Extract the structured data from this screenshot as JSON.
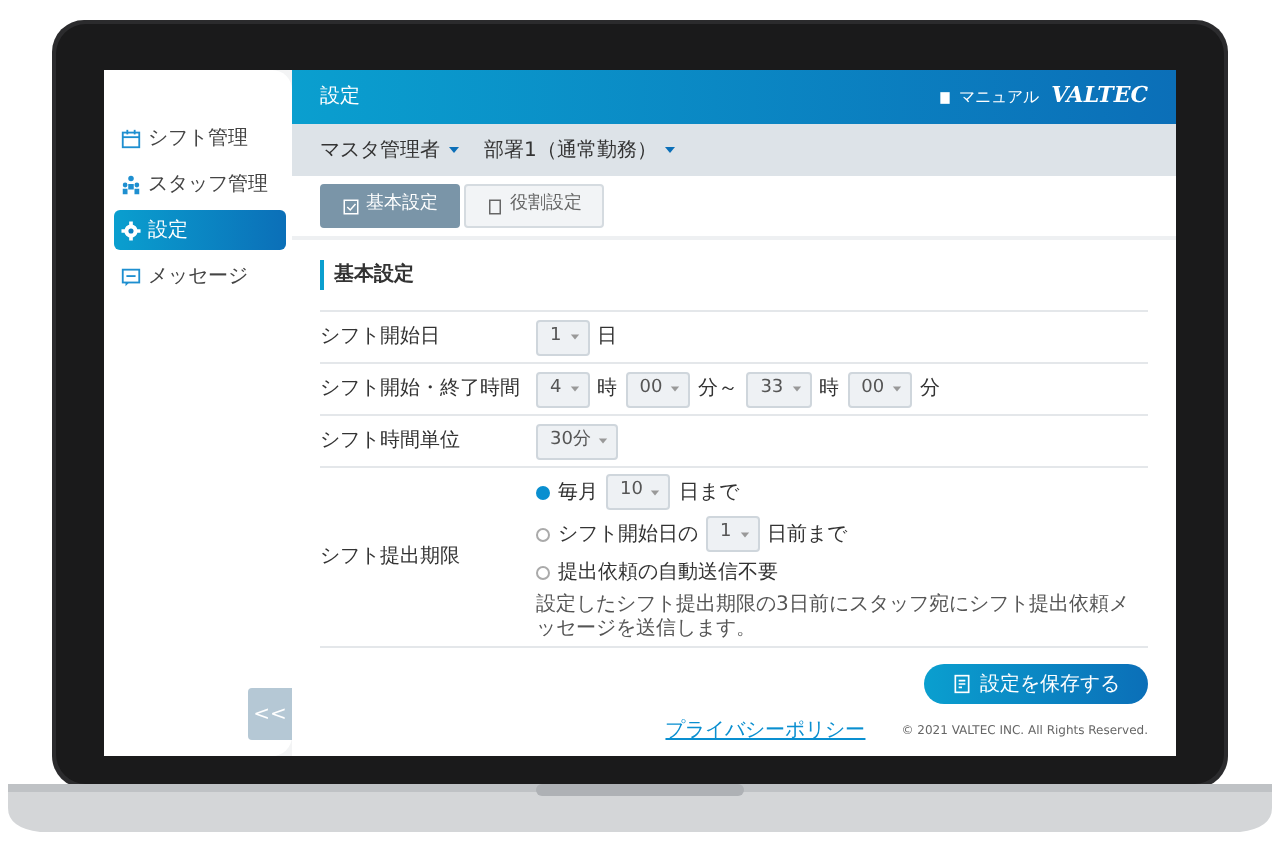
{
  "header": {
    "title": "設定",
    "manual_link": "マニュアル",
    "logo": "VALTEC"
  },
  "sidebar": {
    "items": [
      {
        "label": "シフト管理",
        "selected": false
      },
      {
        "label": "スタッフ管理",
        "selected": false
      },
      {
        "label": "設定",
        "selected": true
      },
      {
        "label": "メッセージ",
        "selected": false
      }
    ],
    "collapse_button": "<<"
  },
  "filters": [
    {
      "label": "マスタ管理者"
    },
    {
      "label": "部署1（通常勤務）"
    }
  ],
  "tabs": [
    {
      "label": "基本設定",
      "selected": true
    },
    {
      "label": "役割設定",
      "selected": false
    }
  ],
  "section_title": "基本設定",
  "form_rows": [
    {
      "label": "シフト開始日",
      "kind": "inline",
      "parts": [
        {
          "kind": "select",
          "value": "1"
        },
        {
          "kind": "text",
          "text": "日"
        }
      ]
    },
    {
      "label": "シフト開始・終了時間",
      "kind": "inline",
      "parts": [
        {
          "kind": "select",
          "value": "4"
        },
        {
          "kind": "text",
          "text": "時"
        },
        {
          "kind": "select",
          "value": "00"
        },
        {
          "kind": "text",
          "text": "分～"
        },
        {
          "kind": "select",
          "value": "33"
        },
        {
          "kind": "text",
          "text": "時"
        },
        {
          "kind": "select",
          "value": "00"
        },
        {
          "kind": "text",
          "text": "分"
        }
      ]
    },
    {
      "label": "シフト時間単位",
      "kind": "inline",
      "parts": [
        {
          "kind": "select",
          "value": "30分"
        }
      ]
    },
    {
      "label": "シフト提出期限",
      "kind": "radio",
      "options": [
        {
          "selected": true,
          "parts": [
            {
              "kind": "text",
              "text": "毎月"
            },
            {
              "kind": "select",
              "value": "10"
            },
            {
              "kind": "text",
              "text": "日まで"
            }
          ]
        },
        {
          "selected": false,
          "parts": [
            {
              "kind": "text",
              "text": "シフト開始日の"
            },
            {
              "kind": "select",
              "value": "1"
            },
            {
              "kind": "text",
              "text": "日前まで"
            }
          ]
        },
        {
          "selected": false,
          "parts": [
            {
              "kind": "text",
              "text": "提出依頼の自動送信不要"
            }
          ]
        }
      ],
      "note": "設定したシフト提出期限の3日前にスタッフ宛にシフト提出依頼メッセージを送信します。"
    }
  ],
  "save_button": "設定を保存する",
  "footer": {
    "privacy_link": "プライバシーポリシー",
    "copyright": "© 2021 VALTEC INC. All Rights Reserved."
  }
}
